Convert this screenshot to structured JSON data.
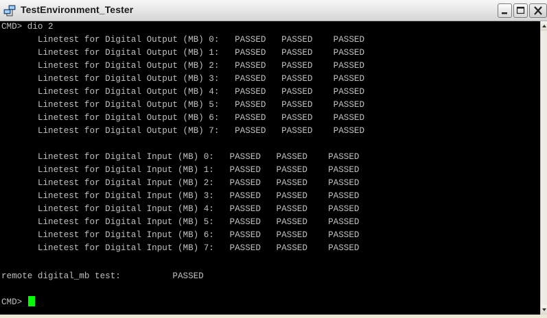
{
  "window": {
    "title": "TestEnvironment_Tester"
  },
  "terminal": {
    "lines": [
      "CMD> dio 2",
      "       Linetest for Digital Output (MB) 0:   PASSED   PASSED    PASSED",
      "       Linetest for Digital Output (MB) 1:   PASSED   PASSED    PASSED",
      "       Linetest for Digital Output (MB) 2:   PASSED   PASSED    PASSED",
      "       Linetest for Digital Output (MB) 3:   PASSED   PASSED    PASSED",
      "       Linetest for Digital Output (MB) 4:   PASSED   PASSED    PASSED",
      "       Linetest for Digital Output (MB) 5:   PASSED   PASSED    PASSED",
      "       Linetest for Digital Output (MB) 6:   PASSED   PASSED    PASSED",
      "       Linetest for Digital Output (MB) 7:   PASSED   PASSED    PASSED",
      "",
      "       Linetest for Digital Input (MB) 0:   PASSED   PASSED    PASSED",
      "       Linetest for Digital Input (MB) 1:   PASSED   PASSED    PASSED",
      "       Linetest for Digital Input (MB) 2:   PASSED   PASSED    PASSED",
      "       Linetest for Digital Input (MB) 3:   PASSED   PASSED    PASSED",
      "       Linetest for Digital Input (MB) 4:   PASSED   PASSED    PASSED",
      "       Linetest for Digital Input (MB) 5:   PASSED   PASSED    PASSED",
      "       Linetest for Digital Input (MB) 6:   PASSED   PASSED    PASSED",
      "       Linetest for Digital Input (MB) 7:   PASSED   PASSED    PASSED",
      "",
      "remote digital_mb test:          PASSED",
      ""
    ],
    "prompt": "CMD> "
  },
  "colors": {
    "terminal_bg": "#000000",
    "terminal_fg": "#c0c0c0",
    "cursor": "#00ff00",
    "titlebar": "#e8e8e8"
  },
  "icons": {
    "app": "network-computers-icon",
    "minimize": "minimize-icon",
    "maximize": "maximize-icon",
    "close": "close-icon",
    "scroll_up": "arrow-up-icon",
    "scroll_down": "arrow-down-icon"
  }
}
